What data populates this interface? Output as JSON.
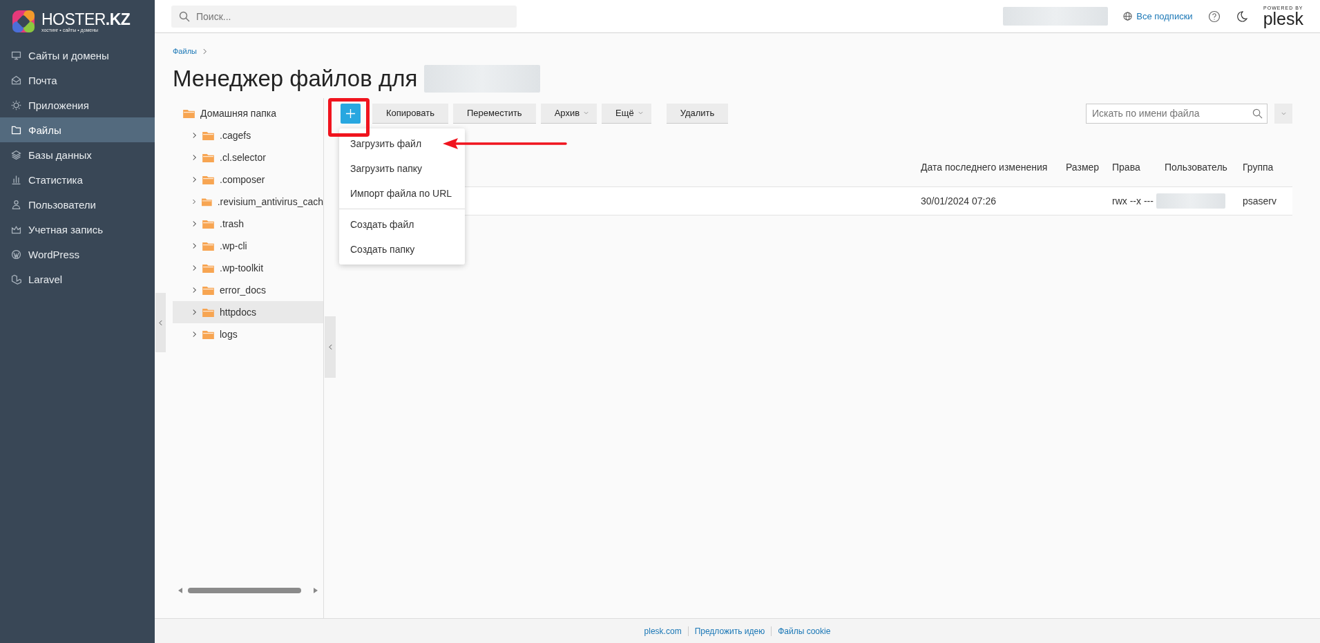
{
  "logo": {
    "name": "HOSTER",
    "tld": ".KZ",
    "tagline": "хостинг • сайты • домены"
  },
  "sidebar": {
    "items": [
      {
        "label": "Сайты и домены",
        "selected": false
      },
      {
        "label": "Почта",
        "selected": false
      },
      {
        "label": "Приложения",
        "selected": false
      },
      {
        "label": "Файлы",
        "selected": true
      },
      {
        "label": "Базы данных",
        "selected": false
      },
      {
        "label": "Статистика",
        "selected": false
      },
      {
        "label": "Пользователи",
        "selected": false
      },
      {
        "label": "Учетная запись",
        "selected": false
      },
      {
        "label": "WordPress",
        "selected": false
      },
      {
        "label": "Laravel",
        "selected": false
      }
    ]
  },
  "topbar": {
    "search": {
      "placeholder": "Поиск..."
    },
    "subscriptions_link": "Все подписки",
    "powered_by": "POWERED BY",
    "brand": "plesk"
  },
  "breadcrumbs": [
    "Файлы"
  ],
  "page_title": "Менеджер файлов для",
  "toolbar": {
    "buttons": [
      {
        "label": "Копировать",
        "kind": "button"
      },
      {
        "label": "Переместить",
        "kind": "button"
      },
      {
        "label": "Архив",
        "kind": "dropdown"
      },
      {
        "label": "Ещё",
        "kind": "dropdown"
      },
      {
        "label": "Удалить",
        "kind": "separate"
      }
    ],
    "search": {
      "placeholder": "Искать по имени файла"
    }
  },
  "add_menu": {
    "groups": [
      [
        "Загрузить файл",
        "Загрузить папку",
        "Импорт файла по URL"
      ],
      [
        "Создать файл",
        "Создать папку"
      ]
    ]
  },
  "tree": {
    "root": "Домашняя папка",
    "children": [
      {
        "name": ".cagefs",
        "expanded": false,
        "selected": false
      },
      {
        "name": ".cl.selector",
        "expanded": false,
        "selected": false
      },
      {
        "name": ".composer",
        "expanded": false,
        "selected": false
      },
      {
        "name": ".revisium_antivirus_cach",
        "expanded": false,
        "selected": false
      },
      {
        "name": ".trash",
        "expanded": false,
        "selected": false
      },
      {
        "name": ".wp-cli",
        "expanded": false,
        "selected": false
      },
      {
        "name": ".wp-toolkit",
        "expanded": false,
        "selected": false
      },
      {
        "name": "error_docs",
        "expanded": false,
        "selected": false
      },
      {
        "name": "httpdocs",
        "expanded": false,
        "selected": true
      },
      {
        "name": "logs",
        "expanded": false,
        "selected": false
      }
    ]
  },
  "table": {
    "columns": [
      "Дата последнего изменения",
      "Размер",
      "Права",
      "Пользователь",
      "Группа"
    ],
    "rows": [
      {
        "modified": "30/01/2024 07:26",
        "permissions": "rwx --x ---",
        "group": "psaserv"
      }
    ]
  },
  "footer": {
    "links": [
      "plesk.com",
      "Предложить идею",
      "Файлы cookie"
    ]
  }
}
